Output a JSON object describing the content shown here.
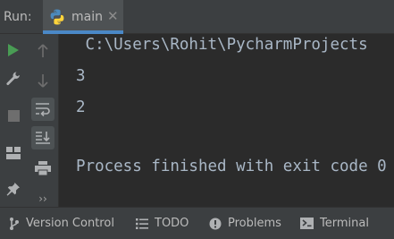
{
  "run_header": {
    "label": "Run:",
    "tab": {
      "label": "main",
      "close_glyph": "✕",
      "icon": "python-icon"
    }
  },
  "toolbar": {
    "column1": [
      {
        "name": "rerun-icon",
        "color": "#499c54"
      },
      {
        "name": "wrench-icon",
        "color": "#afb1b3"
      },
      {
        "name": "stop-icon",
        "color": "#6e6e6e"
      },
      {
        "name": "layout-icon",
        "color": "#afb1b3"
      },
      {
        "name": "pin-icon",
        "color": "#afb1b3"
      }
    ],
    "column2": [
      {
        "name": "arrow-up-icon",
        "color": "#6e6e6e"
      },
      {
        "name": "arrow-down-icon",
        "color": "#6e6e6e"
      },
      {
        "name": "soft-wrap-icon",
        "toggled": true
      },
      {
        "name": "scroll-to-end-icon",
        "toggled": true
      },
      {
        "name": "print-icon",
        "color": "#afb1b3"
      }
    ],
    "more_label": "››"
  },
  "console": {
    "lines": [
      " C:\\Users\\Rohit\\PycharmProjects",
      "3",
      "2",
      "",
      "Process finished with exit code 0"
    ]
  },
  "statusbar": {
    "items": [
      {
        "label": "Version Control",
        "icon": "git-branch-icon"
      },
      {
        "label": "TODO",
        "icon": "todo-list-icon"
      },
      {
        "label": "Problems",
        "icon": "problems-icon"
      },
      {
        "label": "Terminal",
        "icon": "terminal-icon"
      }
    ]
  },
  "colors": {
    "background": "#2b2b2b",
    "panel": "#3c3f41",
    "accent": "#4a88c7",
    "run_green": "#499c54",
    "text": "#a9b7c6"
  }
}
